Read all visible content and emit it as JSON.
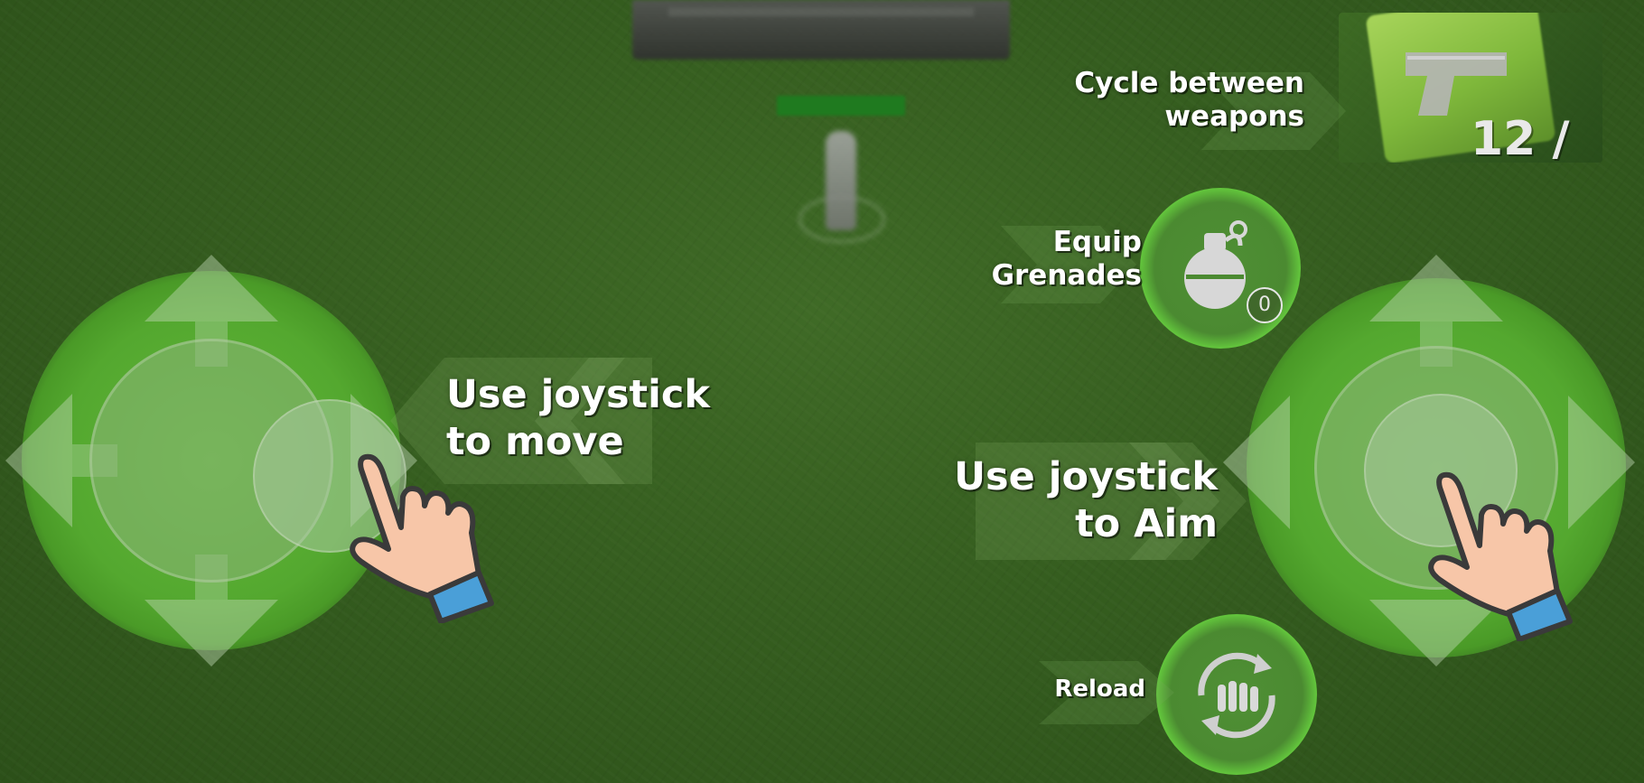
{
  "hud": {
    "weapons_label_line1": "Cycle between",
    "weapons_label_line2": "weapons",
    "grenade_label_line1": "Equip",
    "grenade_label_line2": "Grenades",
    "grenade_count": "0",
    "move_label_line1": "Use joystick",
    "move_label_line2": "to move",
    "aim_label_line1": "Use joystick",
    "aim_label_line2": "to Aim",
    "reload_label": "Reload",
    "ammo_text": "12 / "
  },
  "icons": {
    "weapon": "pistol-icon",
    "grenade": "grenade-icon",
    "reload": "reload-ammo-icon",
    "hand": "pointing-hand-icon"
  },
  "colors": {
    "grass": "#355d1f",
    "joystick_glow": "#5fb53a",
    "cuff": "#4a9fd8",
    "skin": "#f7c6a8",
    "text": "#ffffff"
  }
}
